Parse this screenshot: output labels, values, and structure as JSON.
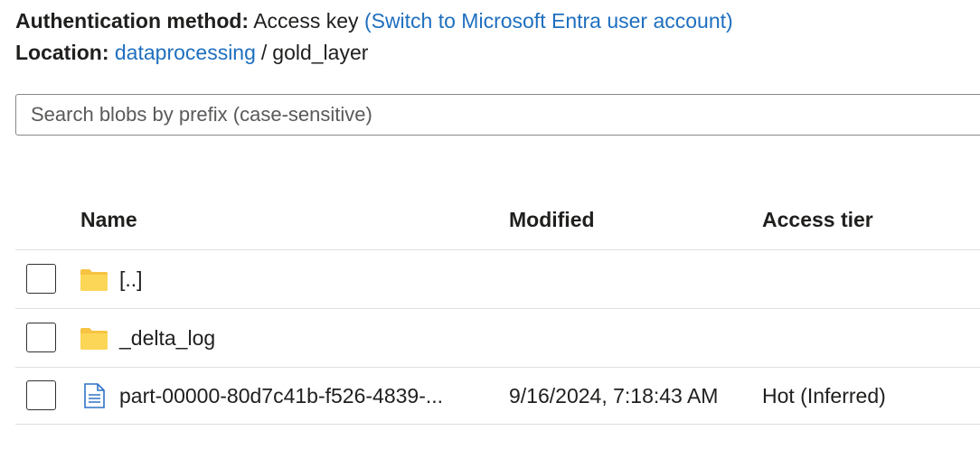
{
  "auth": {
    "label": "Authentication method:",
    "value": "Access key",
    "switch_link": "(Switch to Microsoft Entra user account)"
  },
  "location": {
    "label": "Location:",
    "container": "dataprocessing",
    "separator": "/",
    "folder": "gold_layer"
  },
  "search": {
    "placeholder": "Search blobs by prefix (case-sensitive)",
    "value": ""
  },
  "table": {
    "headers": {
      "name": "Name",
      "modified": "Modified",
      "access_tier": "Access tier"
    },
    "rows": [
      {
        "icon": "folder-icon",
        "name": "[..]",
        "modified": "",
        "access_tier": ""
      },
      {
        "icon": "folder-icon",
        "name": "_delta_log",
        "modified": "",
        "access_tier": ""
      },
      {
        "icon": "file-icon",
        "name": "part-00000-80d7c41b-f526-4839-...",
        "modified": "9/16/2024, 7:18:43 AM",
        "access_tier": "Hot (Inferred)"
      }
    ]
  },
  "colors": {
    "link": "#1e6fbf",
    "folder": "#f6c342",
    "file": "#2f72c4"
  }
}
